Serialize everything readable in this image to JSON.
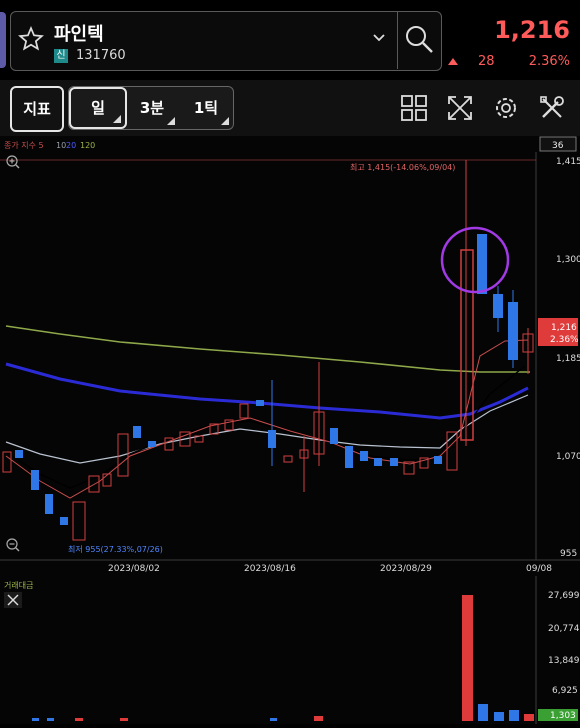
{
  "header": {
    "stock_name": "파인텍",
    "market_badge": "신",
    "stock_code": "131760",
    "price": "1,216",
    "change_abs": "28",
    "change_pct": "2.36%",
    "colors": {
      "up": "#ff5b5b",
      "down": "#3a8dff",
      "accent": "#5d5aa8"
    }
  },
  "toolbar": {
    "indicator_label": "지표",
    "periods": [
      {
        "label": "일",
        "active": true
      },
      {
        "label": "3분",
        "active": false
      },
      {
        "label": "1틱",
        "active": false
      }
    ],
    "icons": [
      "layout-grid-icon",
      "expand-icon",
      "settings-gear-icon",
      "tools-icon"
    ]
  },
  "chart": {
    "legend_prefix": "종가 지수 5",
    "legend_ma10": "10",
    "legend_ma20": "20",
    "legend_ma120": "120",
    "count_box": "36",
    "high_annotation": "최고 1,415(-14.06%,09/04)",
    "low_annotation": "최저 955(27.33%,07/26)",
    "price_labels": [
      "1,415",
      "1,300",
      "1,185",
      "1,070",
      "955"
    ],
    "current_price_label": "1,216",
    "current_pct_label": "2.36%",
    "date_labels": [
      "2023/08/02",
      "2023/08/16",
      "2023/08/29",
      "09/08"
    ]
  },
  "volume": {
    "title": "거래대금",
    "labels": [
      "27,699",
      "20,774",
      "13,849",
      "6,925"
    ],
    "current_label": "1,303"
  }
}
